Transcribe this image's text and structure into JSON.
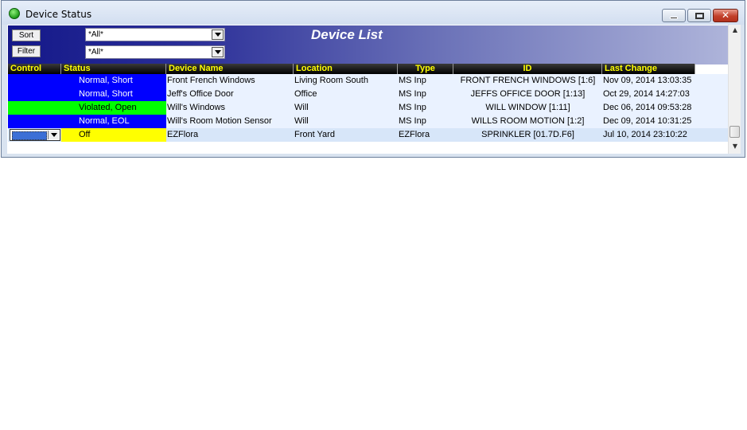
{
  "window": {
    "title": "Device Status",
    "close_glyph": "✕"
  },
  "toolbar": {
    "sort_label": "Sort",
    "filter_label": "Filter",
    "sort_value": "*All*",
    "filter_value": "*All*",
    "list_title": "Device List"
  },
  "columns": {
    "control": "Control",
    "status": "Status",
    "device_name": "Device Name",
    "location": "Location",
    "type": "Type",
    "id": "ID",
    "last_change": "Last Change"
  },
  "rows": [
    {
      "control_color": "#0000ff",
      "status": "Normal, Short",
      "status_color": "#0000ff",
      "status_text_color": "#ffffff",
      "device_name": "Front French Windows",
      "location": "Living Room South",
      "type": "MS Inp",
      "id": "FRONT FRENCH WINDOWS [1:6]",
      "last_change": "Nov 09, 2014 13:03:35"
    },
    {
      "control_color": "#0000ff",
      "status": "Normal, Short",
      "status_color": "#0000ff",
      "status_text_color": "#ffffff",
      "device_name": "Jeff's Office Door",
      "location": "Office",
      "type": "MS Inp",
      "id": "JEFFS OFFICE DOOR [1:13]",
      "last_change": "Oct 29, 2014 14:27:03"
    },
    {
      "control_color": "#00ff00",
      "status": "Violated, Open",
      "status_color": "#00ff00",
      "status_text_color": "#000000",
      "device_name": "Will's Windows",
      "location": "Will",
      "type": "MS Inp",
      "id": "WILL WINDOW [1:11]",
      "last_change": "Dec 06, 2014 09:53:28"
    },
    {
      "control_color": "#0000ff",
      "status": "Normal, EOL",
      "status_color": "#0000ff",
      "status_text_color": "#ffffff",
      "device_name": "Will's Room Motion Sensor",
      "location": "Will",
      "type": "MS Inp",
      "id": "WILLS ROOM MOTION [1:2]",
      "last_change": "Dec 09, 2014 10:31:25"
    },
    {
      "control_color": "",
      "status": "Off",
      "status_color": "#ffff00",
      "status_text_color": "#000000",
      "device_name": "EZFlora",
      "location": "Front Yard",
      "type": "EZFlora",
      "id": "SPRINKLER [01.7D.F6]",
      "last_change": "Jul 10, 2014 23:10:22"
    }
  ],
  "scrollbar": {
    "up_arrow": "▲",
    "down_arrow": "▼"
  }
}
